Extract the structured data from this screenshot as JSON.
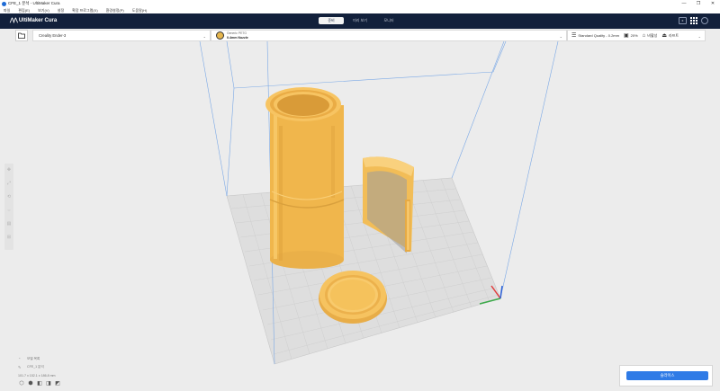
{
  "window": {
    "title": "CFE_1 분석 - UltiMaker Cura",
    "controls": [
      "—",
      "❐",
      "✕"
    ]
  },
  "menu": [
    "파일",
    "편집(E)",
    "보기(V)",
    "설정",
    "확장 프로그램(X)",
    "환경설정(P)",
    "도움말(H)"
  ],
  "header": {
    "logo_mark": "⋀⋀",
    "logo_text": "UltiMaker Cura",
    "tabs": [
      {
        "label": "준비",
        "active": true
      },
      {
        "label": "미리 보기",
        "active": false
      },
      {
        "label": "모니터",
        "active": false
      }
    ],
    "right_box_label": "≡"
  },
  "toolbar": {
    "open_icon": "folder-icon",
    "printer_label": "Creality Ender-3",
    "material_line1": "Generic PETG",
    "material_line2": "0.4mm Nozzle",
    "quality": "Standard Quality - 0.2mm",
    "infill": "20%",
    "support": "비활성",
    "adhesion": "라프트"
  },
  "tools": [
    "✥",
    "⤢",
    "⟲",
    "⇔",
    "▤",
    "⊞"
  ],
  "objinfo": {
    "list_label": "모델 목록",
    "object_name": "CFE_1 분석",
    "dimensions": "101.7 x 152.1 x 186.8 mm"
  },
  "view_buttons": [
    "⬡",
    "⬢",
    "◧",
    "◨",
    "◩"
  ],
  "slice_button": "슬라이스",
  "colors": {
    "header_bg": "#12203b",
    "model_fill": "#f5c15d",
    "accent": "#2f7be6"
  }
}
